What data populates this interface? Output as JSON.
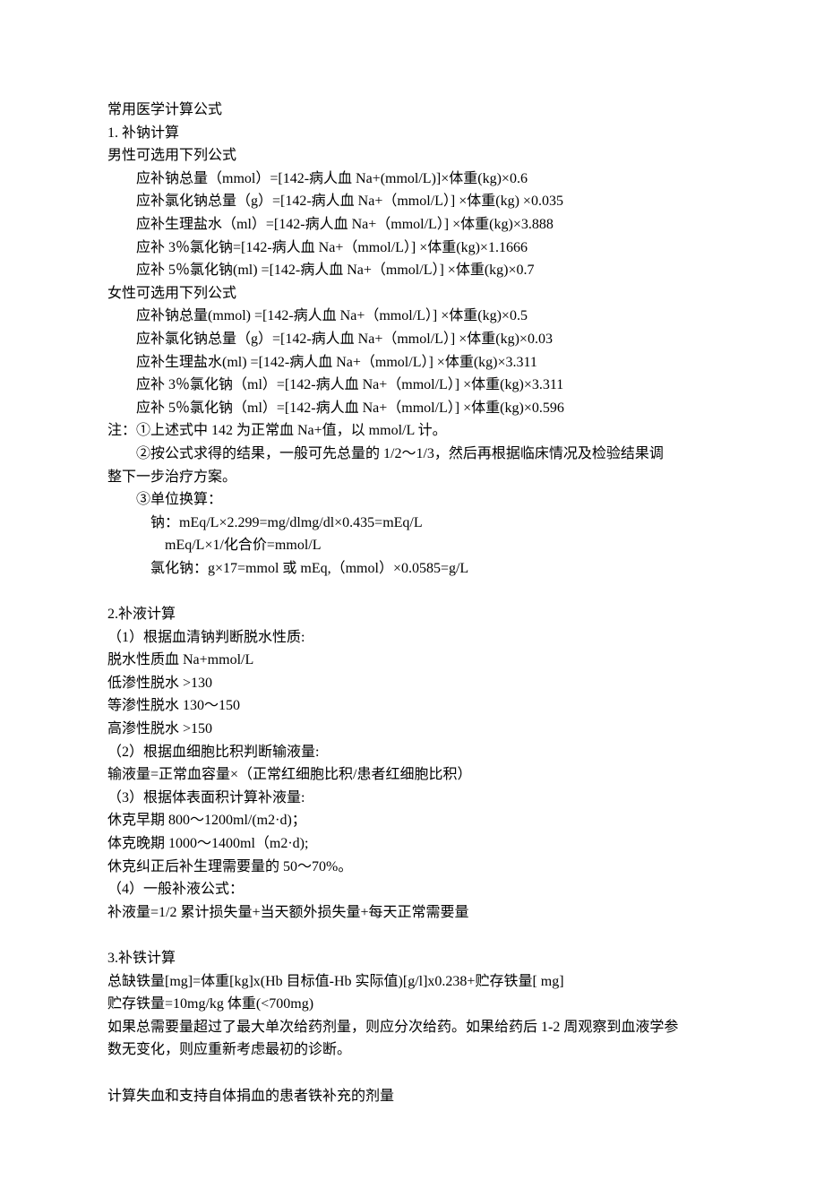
{
  "title": "常用医学计算公式",
  "s1": {
    "heading": "1. 补钠计算",
    "male_intro": "男性可选用下列公式",
    "male": [
      "应补钠总量（mmol）=[142-病人血 Na+(mmol/L)]×体重(kg)×0.6",
      "应补氯化钠总量（g）=[142-病人血 Na+（mmol/L）] ×体重(kg) ×0.035",
      "应补生理盐水（ml）=[142-病人血 Na+（mmol/L）] ×体重(kg)×3.888",
      "应补 3％氯化钠=[142-病人血 Na+（mmol/L）] ×体重(kg)×1.1666",
      "应补 5％氯化钠(ml) =[142-病人血 Na+（mmol/L）] ×体重(kg)×0.7"
    ],
    "female_intro": "女性可选用下列公式",
    "female": [
      "应补钠总量(mmol) =[142-病人血 Na+（mmol/L）] ×体重(kg)×0.5",
      "应补氯化钠总量（g）=[142-病人血 Na+（mmol/L）] ×体重(kg)×0.03",
      "应补生理盐水(ml) =[142-病人血 Na+（mmol/L）] ×体重(kg)×3.311",
      "应补 3％氯化钠（ml）=[142-病人血 Na+（mmol/L）] ×体重(kg)×3.311",
      "应补 5％氯化钠（ml）=[142-病人血 Na+（mmol/L）] ×体重(kg)×0.596"
    ],
    "note1": "注：①上述式中 142 为正常血 Na+值，以 mmol/L 计。",
    "note2": "②按公式求得的结果，一般可先总量的 1/2～1/3，然后再根据临床情况及检验结果调",
    "note2b": "整下一步治疗方案。",
    "note3": "③单位换算：",
    "note3a": "钠：mEq/L×2.299=mg/dlmg/dl×0.435=mEq/L",
    "note3b": "mEq/L×1/化合价=mmol/L",
    "note3c": "氯化钠：g×17=mmol 或 mEq,（mmol）×0.0585=g/L"
  },
  "s2": {
    "heading": "2.补液计算",
    "lines": [
      "（1）根据血清钠判断脱水性质:",
      "脱水性质血 Na+mmol/L",
      "低渗性脱水 >130",
      "等渗性脱水 130～150",
      "高渗性脱水 >150",
      "（2）根据血细胞比积判断输液量:",
      "输液量=正常血容量×（正常红细胞比积/患者红细胞比积）",
      "（3）根据体表面积计算补液量:",
      "休克早期 800～1200ml/(m2·d)；",
      "体克晚期 1000～1400ml（m2·d);",
      "休克纠正后补生理需要量的 50～70%。",
      "（4）一般补液公式：",
      "补液量=1/2 累计损失量+当天额外损失量+每天正常需要量"
    ]
  },
  "s3": {
    "heading": "3.补铁计算",
    "lines": [
      "总缺铁量[mg]=体重[kg]x(Hb 目标值-Hb 实际值)[g/l]x0.238+贮存铁量[ mg]",
      "贮存铁量=10mg/kg 体重(<700mg)",
      "如果总需要量超过了最大单次给药剂量，则应分次给药。如果给药后 1-2 周观察到血液学参",
      "数无变化，则应重新考虑最初的诊断。"
    ],
    "last": "计算失血和支持自体捐血的患者铁补充的剂量"
  }
}
